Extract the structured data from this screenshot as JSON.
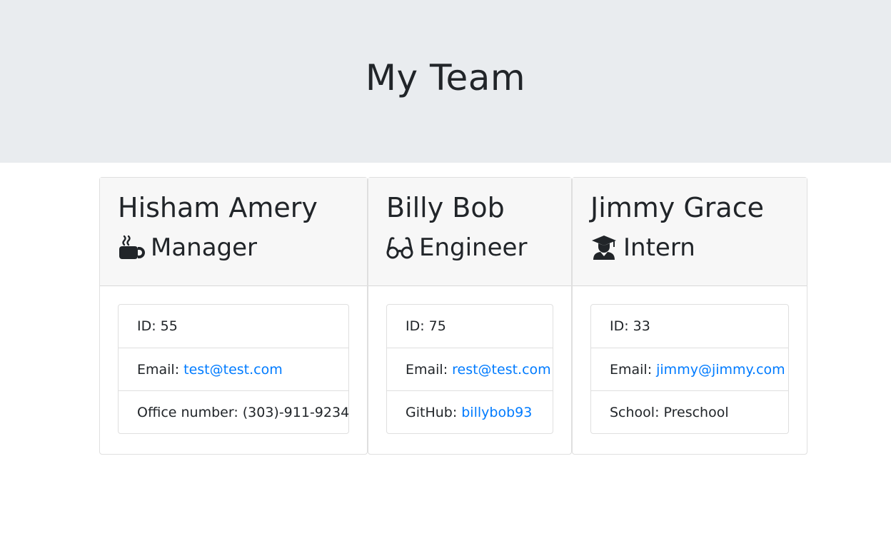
{
  "header": {
    "title": "My Team"
  },
  "colors": {
    "link": "#007bff",
    "jumbotron": "#e9ecef",
    "card_header": "#f7f7f7"
  },
  "team": [
    {
      "name": "Hisham Amery",
      "role": "Manager",
      "role_icon": "coffee-mug-icon",
      "id_label": "ID:",
      "id": "55",
      "email_label": "Email:",
      "email": "test@test.com",
      "extra_label": "Office number:",
      "extra_value": "(303)-911-9234"
    },
    {
      "name": "Billy Bob",
      "role": "Engineer",
      "role_icon": "glasses-icon",
      "id_label": "ID:",
      "id": "75",
      "email_label": "Email:",
      "email": "rest@test.com",
      "extra_label": "GitHub:",
      "extra_value": "billybob93"
    },
    {
      "name": "Jimmy Grace",
      "role": "Intern",
      "role_icon": "graduate-icon",
      "id_label": "ID:",
      "id": "33",
      "email_label": "Email:",
      "email": "jimmy@jimmy.com",
      "extra_label": "School:",
      "extra_value": "Preschool"
    }
  ]
}
